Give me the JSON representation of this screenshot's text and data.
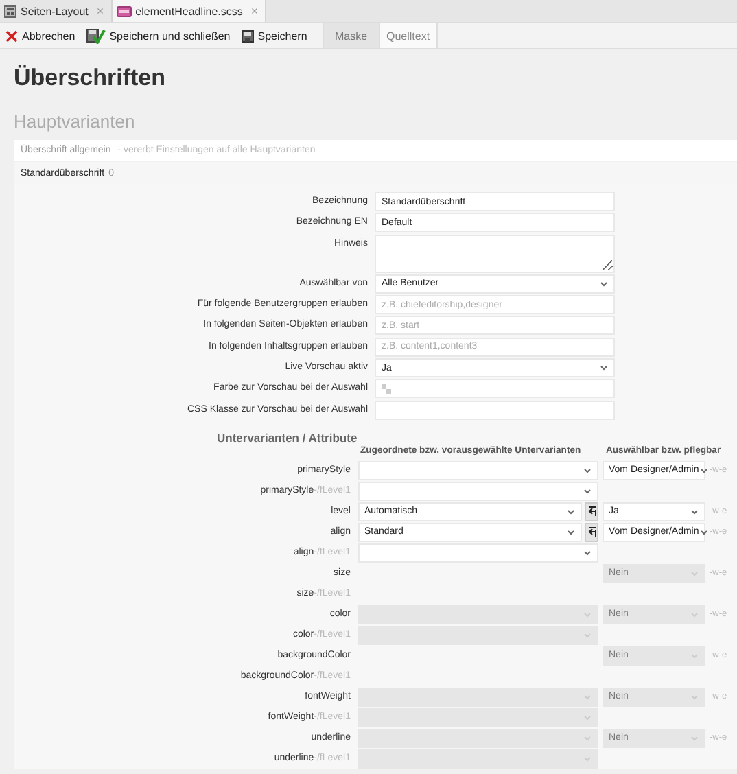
{
  "tabs": [
    {
      "label": "Seiten-Layout",
      "close": "×",
      "selected": false
    },
    {
      "label": "elementHeadline.scss",
      "close": "×",
      "selected": true
    }
  ],
  "toolbar": {
    "buttons": [
      {
        "label": "Abbrechen"
      },
      {
        "label": "Speichern und schließen"
      },
      {
        "label": "Speichern"
      }
    ],
    "views": [
      {
        "label": "Maske",
        "selected": true
      },
      {
        "label": "Quelltext",
        "selected": false
      }
    ]
  },
  "page_title": "Überschriften",
  "section_title": "Hauptvarianten",
  "group": {
    "title": "Überschrift allgemein",
    "note": "- vererbt Einstellungen auf alle Hauptvarianten"
  },
  "variant": {
    "name": "Standardüberschrift",
    "count": "0"
  },
  "fields": [
    {
      "label": "Bezeichnung",
      "kind": "text",
      "value": "Standardüberschrift"
    },
    {
      "label": "Bezeichnung EN",
      "kind": "text",
      "value": "Default"
    },
    {
      "label": "Hinweis",
      "kind": "textarea"
    },
    {
      "label": "Auswählbar von",
      "kind": "select",
      "value": "Alle Benutzer"
    },
    {
      "label": "Für folgende Benutzergruppen erlauben",
      "kind": "text",
      "placeholder": "z.B. chiefeditorship,designer"
    },
    {
      "label": "In folgenden Seiten-Objekten erlauben",
      "kind": "text",
      "placeholder": "z.B. start"
    },
    {
      "label": "In folgenden Inhaltsgruppen erlauben",
      "kind": "text",
      "placeholder": "z.B. content1,content3"
    },
    {
      "label": "Live Vorschau aktiv",
      "kind": "select",
      "value": "Ja"
    },
    {
      "label": "Farbe zur Vorschau bei der Auswahl",
      "kind": "color"
    },
    {
      "label": "CSS Klasse zur Vorschau bei der Auswahl",
      "kind": "text"
    }
  ],
  "attributes": {
    "title": "Untervarianten / Attribute",
    "columns": [
      "Zugeordnete bzw. vorausgewählte Untervarianten",
      "Auswählbar bzw. pflegbar"
    ],
    "rows": [
      {
        "label": "primaryStyle",
        "variant": {
          "disabled": false
        },
        "availability": {
          "value": "Vom Designer/Admin",
          "disabled": false
        },
        "extra": "-w-e"
      },
      {
        "label": "primaryStyle",
        "suffix": "-/fLevel1",
        "variant": {
          "disabled": false
        }
      },
      {
        "label": "level",
        "variant": {
          "value": "Automatisch",
          "disabled": false
        },
        "reset": true,
        "availability": {
          "value": "Ja",
          "disabled": false
        },
        "extra": "-w-e"
      },
      {
        "label": "align",
        "variant": {
          "value": "Standard",
          "disabled": false
        },
        "reset": true,
        "availability": {
          "value": "Vom Designer/Admin",
          "disabled": false
        },
        "extra": "-w-e"
      },
      {
        "label": "align",
        "suffix": "-/fLevel1",
        "variant": {
          "disabled": false
        }
      },
      {
        "label": "size",
        "availability": {
          "value": "Nein",
          "disabled": true
        },
        "extra": "-w-e"
      },
      {
        "label": "size",
        "suffix": "-/fLevel1"
      },
      {
        "label": "color",
        "variant": {
          "disabled": true
        },
        "availability": {
          "value": "Nein",
          "disabled": true
        },
        "extra": "-w-e"
      },
      {
        "label": "color",
        "suffix": "-/fLevel1",
        "variant": {
          "disabled": true
        }
      },
      {
        "label": "backgroundColor",
        "availability": {
          "value": "Nein",
          "disabled": true
        },
        "extra": "-w-e"
      },
      {
        "label": "backgroundColor",
        "suffix": "-/fLevel1"
      },
      {
        "label": "fontWeight",
        "variant": {
          "disabled": true
        },
        "availability": {
          "value": "Nein",
          "disabled": true
        },
        "extra": "-w-e"
      },
      {
        "label": "fontWeight",
        "suffix": "-/fLevel1",
        "variant": {
          "disabled": true
        }
      },
      {
        "label": "underline",
        "variant": {
          "disabled": true
        },
        "availability": {
          "value": "Nein",
          "disabled": true
        },
        "extra": "-w-e"
      },
      {
        "label": "underline",
        "suffix": "-/fLevel1",
        "variant": {
          "disabled": true
        }
      }
    ]
  }
}
